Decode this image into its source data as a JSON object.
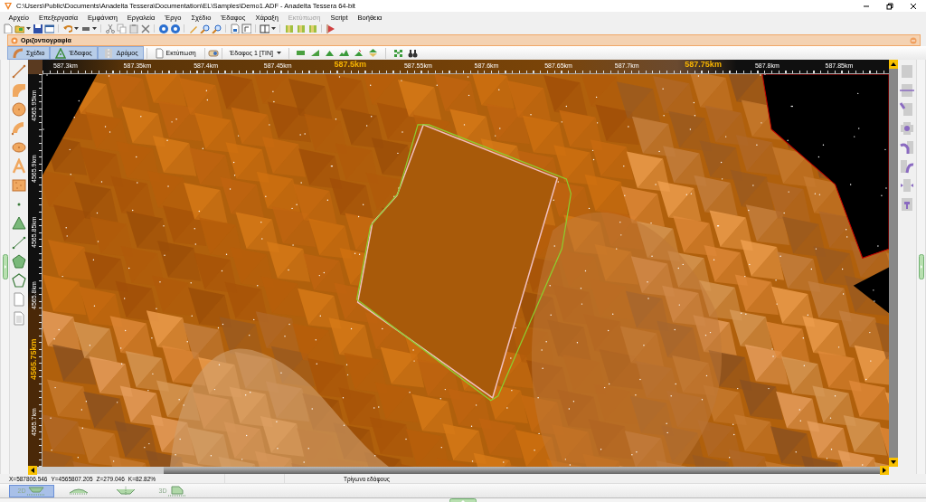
{
  "window": {
    "title": "C:\\Users\\Public\\Documents\\Anadelta Tessera\\Documentation\\EL\\Samples\\Demo1.ADF - Anadelta Tessera 64-bit"
  },
  "menu": [
    {
      "label": "Αρχείο",
      "disabled": false
    },
    {
      "label": "Επεξεργασία",
      "disabled": false
    },
    {
      "label": "Εμφάνιση",
      "disabled": false
    },
    {
      "label": "Εργαλεία",
      "disabled": false
    },
    {
      "label": "Έργο",
      "disabled": false
    },
    {
      "label": "Σχέδιο",
      "disabled": false
    },
    {
      "label": "Έδαφος",
      "disabled": false
    },
    {
      "label": "Χάραξη",
      "disabled": false
    },
    {
      "label": "Εκτύπωση",
      "disabled": true
    },
    {
      "label": "Script",
      "disabled": false
    },
    {
      "label": "Βοήθεια",
      "disabled": false
    }
  ],
  "panel": {
    "title": "Οριζοντιογραφία",
    "tabs": [
      {
        "label": "Σχέδιο",
        "selected": true
      },
      {
        "label": "Έδαφος",
        "selected": true
      },
      {
        "label": "Δρόμος",
        "selected": true
      }
    ],
    "print_button": "Εκτύπωση",
    "surface_dropdown": {
      "value": "Έδαφος 1 [TIN]"
    }
  },
  "map": {
    "x_ruler": [
      {
        "label": "587.3km",
        "major": false
      },
      {
        "label": "587.35km",
        "major": false
      },
      {
        "label": "587.4km",
        "major": false
      },
      {
        "label": "587.45km",
        "major": false
      },
      {
        "label": "587.5km",
        "major": true
      },
      {
        "label": "587.55km",
        "major": false
      },
      {
        "label": "587.6km",
        "major": false
      },
      {
        "label": "587.65km",
        "major": false
      },
      {
        "label": "587.7km",
        "major": false
      },
      {
        "label": "587.75km",
        "major": true
      },
      {
        "label": "587.8km",
        "major": false
      },
      {
        "label": "587.85km",
        "major": false
      }
    ],
    "y_ruler": [
      {
        "label": "4565.95km",
        "major": false
      },
      {
        "label": "4565.9km",
        "major": false
      },
      {
        "label": "4565.85km",
        "major": false
      },
      {
        "label": "4565.8km",
        "major": false
      },
      {
        "label": "4565.75km",
        "major": true
      },
      {
        "label": "4565.7km",
        "major": false
      }
    ]
  },
  "status_bar": {
    "coordinates": [
      "X=587806.546",
      "Y=4565807.205",
      "Z=279.046",
      "K=82.82%"
    ],
    "info": "Τρίγωνο εδάφους"
  },
  "view_tabs": [
    {
      "kind": "plan",
      "label": "2D",
      "selected": true
    },
    {
      "kind": "long-profile",
      "selected": false
    },
    {
      "kind": "cross-section",
      "selected": false
    },
    {
      "kind": "model",
      "label": "3D",
      "selected": false
    }
  ]
}
